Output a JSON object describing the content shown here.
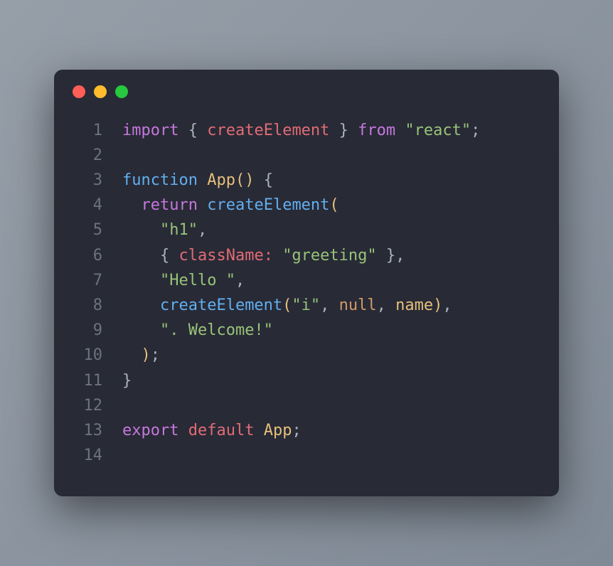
{
  "editor": {
    "traffic_lights": [
      "red",
      "yellow",
      "green"
    ],
    "lines": [
      {
        "n": "1",
        "tokens": [
          {
            "cls": "tok-keyword",
            "t": "import"
          },
          {
            "cls": "tok-plain",
            "t": " "
          },
          {
            "cls": "tok-punct",
            "t": "{"
          },
          {
            "cls": "tok-plain",
            "t": " "
          },
          {
            "cls": "tok-default",
            "t": "createElement"
          },
          {
            "cls": "tok-plain",
            "t": " "
          },
          {
            "cls": "tok-punct",
            "t": "}"
          },
          {
            "cls": "tok-plain",
            "t": " "
          },
          {
            "cls": "tok-keyword",
            "t": "from"
          },
          {
            "cls": "tok-plain",
            "t": " "
          },
          {
            "cls": "tok-str",
            "t": "\"react\""
          },
          {
            "cls": "tok-punct",
            "t": ";"
          }
        ]
      },
      {
        "n": "2",
        "tokens": []
      },
      {
        "n": "3",
        "tokens": [
          {
            "cls": "tok-keyword2",
            "t": "function"
          },
          {
            "cls": "tok-plain",
            "t": " "
          },
          {
            "cls": "tok-func",
            "t": "App"
          },
          {
            "cls": "tok-paren",
            "t": "()"
          },
          {
            "cls": "tok-plain",
            "t": " "
          },
          {
            "cls": "tok-punct",
            "t": "{"
          }
        ]
      },
      {
        "n": "4",
        "tokens": [
          {
            "cls": "tok-plain",
            "t": "  "
          },
          {
            "cls": "tok-keyword",
            "t": "return"
          },
          {
            "cls": "tok-plain",
            "t": " "
          },
          {
            "cls": "tok-call",
            "t": "createElement"
          },
          {
            "cls": "tok-paren",
            "t": "("
          }
        ]
      },
      {
        "n": "5",
        "tokens": [
          {
            "cls": "tok-plain",
            "t": "    "
          },
          {
            "cls": "tok-str",
            "t": "\"h1\""
          },
          {
            "cls": "tok-punct",
            "t": ","
          }
        ]
      },
      {
        "n": "6",
        "tokens": [
          {
            "cls": "tok-plain",
            "t": "    "
          },
          {
            "cls": "tok-punct",
            "t": "{"
          },
          {
            "cls": "tok-plain",
            "t": " "
          },
          {
            "cls": "tok-prop",
            "t": "className:"
          },
          {
            "cls": "tok-plain",
            "t": " "
          },
          {
            "cls": "tok-str",
            "t": "\"greeting\""
          },
          {
            "cls": "tok-plain",
            "t": " "
          },
          {
            "cls": "tok-punct",
            "t": "},"
          }
        ]
      },
      {
        "n": "7",
        "tokens": [
          {
            "cls": "tok-plain",
            "t": "    "
          },
          {
            "cls": "tok-str",
            "t": "\"Hello \""
          },
          {
            "cls": "tok-punct",
            "t": ","
          }
        ]
      },
      {
        "n": "8",
        "tokens": [
          {
            "cls": "tok-plain",
            "t": "    "
          },
          {
            "cls": "tok-call",
            "t": "createElement"
          },
          {
            "cls": "tok-paren",
            "t": "("
          },
          {
            "cls": "tok-str",
            "t": "\"i\""
          },
          {
            "cls": "tok-punct",
            "t": ", "
          },
          {
            "cls": "tok-null",
            "t": "null"
          },
          {
            "cls": "tok-punct",
            "t": ", "
          },
          {
            "cls": "tok-var",
            "t": "name"
          },
          {
            "cls": "tok-paren",
            "t": ")"
          },
          {
            "cls": "tok-punct",
            "t": ","
          }
        ]
      },
      {
        "n": "9",
        "tokens": [
          {
            "cls": "tok-plain",
            "t": "    "
          },
          {
            "cls": "tok-str",
            "t": "\". Welcome!\""
          }
        ]
      },
      {
        "n": "10",
        "tokens": [
          {
            "cls": "tok-plain",
            "t": "  "
          },
          {
            "cls": "tok-paren",
            "t": ")"
          },
          {
            "cls": "tok-punct",
            "t": ";"
          }
        ]
      },
      {
        "n": "11",
        "tokens": [
          {
            "cls": "tok-punct",
            "t": "}"
          }
        ]
      },
      {
        "n": "12",
        "tokens": []
      },
      {
        "n": "13",
        "tokens": [
          {
            "cls": "tok-keyword",
            "t": "export"
          },
          {
            "cls": "tok-plain",
            "t": " "
          },
          {
            "cls": "tok-default",
            "t": "default"
          },
          {
            "cls": "tok-plain",
            "t": " "
          },
          {
            "cls": "tok-var",
            "t": "App"
          },
          {
            "cls": "tok-punct",
            "t": ";"
          }
        ]
      },
      {
        "n": "14",
        "tokens": []
      }
    ]
  }
}
